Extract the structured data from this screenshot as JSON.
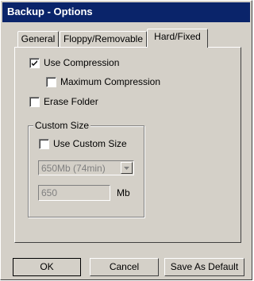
{
  "window": {
    "title": "Backup - Options"
  },
  "tabs": [
    {
      "label": "General",
      "active": false
    },
    {
      "label": "Floppy/Removable",
      "active": false
    },
    {
      "label": "Hard/Fixed",
      "active": true
    }
  ],
  "options": {
    "use_compression": {
      "label": "Use Compression",
      "checked": true
    },
    "maximum_compression": {
      "label": "Maximum Compression",
      "checked": false
    },
    "erase_folder": {
      "label": "Erase Folder",
      "checked": false
    }
  },
  "custom_size": {
    "group_label": "Custom Size",
    "use_custom_size": {
      "label": "Use Custom Size",
      "checked": false
    },
    "size_select": {
      "value": "650Mb (74min)",
      "enabled": false
    },
    "size_input": {
      "value": "650",
      "enabled": false
    },
    "unit_label": "Mb"
  },
  "buttons": {
    "ok": "OK",
    "cancel": "Cancel",
    "save_default": "Save As Default"
  },
  "colors": {
    "face": "#d4d0c8",
    "titlebar": "#0a246a",
    "title_text": "#ffffff",
    "disabled_text": "#808080"
  }
}
